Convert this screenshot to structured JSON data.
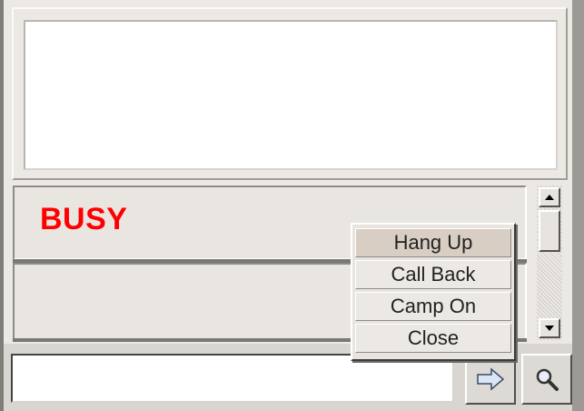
{
  "display": {
    "text": ""
  },
  "calls": [
    {
      "status": "BUSY",
      "status_color": "#ff0000"
    },
    {
      "status": ""
    }
  ],
  "context_menu": {
    "items": [
      {
        "label": "Hang Up",
        "highlighted": true
      },
      {
        "label": "Call Back",
        "highlighted": false
      },
      {
        "label": "Camp On",
        "highlighted": false
      },
      {
        "label": "Close",
        "highlighted": false
      }
    ]
  },
  "scrollbar": {
    "up_icon": "scroll-up-arrow-icon",
    "down_icon": "scroll-down-arrow-icon"
  },
  "bottom_bar": {
    "dial_input_value": "",
    "send_icon": "right-arrow-icon",
    "search_icon": "magnifier-icon"
  }
}
